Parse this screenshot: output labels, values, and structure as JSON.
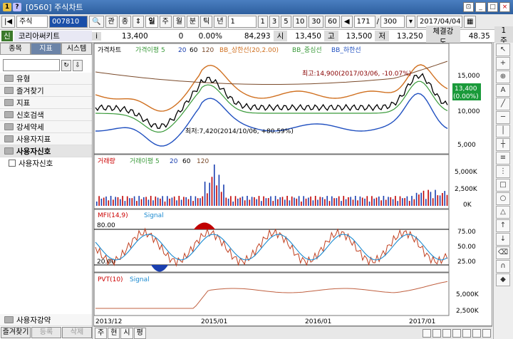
{
  "window": {
    "title": "[0560] 주식차트"
  },
  "toolbar": {
    "market": "주식",
    "code": "007810",
    "periods": [
      "일",
      "주",
      "월",
      "분",
      "틱",
      "년"
    ],
    "minutes": [
      "1",
      "3",
      "5",
      "10",
      "30",
      "60"
    ],
    "count": "171",
    "count_total": "300",
    "date": "2017/04/04",
    "check_labels": [
      "관",
      "종"
    ]
  },
  "quote": {
    "badge": "신",
    "name": "코리아써키트",
    "price": "13,400",
    "change": "0",
    "rate": "0.00%",
    "volume": "84,293",
    "open_label": "시",
    "open": "13,450",
    "high_label": "고",
    "high": "13,500",
    "low_label": "저",
    "low": "13,250",
    "strength_label": "체결강도",
    "strength": "48.35",
    "unit": "1주"
  },
  "sidebar": {
    "tabs": [
      "종목",
      "지표",
      "시스템"
    ],
    "folders": [
      "유형",
      "즐겨찾기",
      "지표",
      "신호검색",
      "강세약세",
      "사용자지표",
      "사용자신호"
    ],
    "sub_item": "사용자신호",
    "bottom_folder": "사용자강약",
    "foot": [
      "즐겨찾기",
      "등록",
      "삭제"
    ]
  },
  "price_panel": {
    "legend": [
      "가격차트",
      "가격이평 5",
      "20",
      "60",
      "120",
      "BB_상한선(20,2.00)",
      "BB_중심선",
      "BB_하한선"
    ],
    "max_note": "최고:14,900(2017/03/06, -10.07%)",
    "min_note": "최저:7,420(2014/10/06, +80.59%)",
    "ticks": [
      "15,000",
      "10,000",
      "5,000"
    ],
    "current": "13,400",
    "current_rate": "(0.00%)"
  },
  "volume_panel": {
    "legend": [
      "거래량",
      "거래이평 5",
      "20",
      "60",
      "120"
    ],
    "ticks": [
      "5,000K",
      "2,500K",
      "0K"
    ]
  },
  "mfi_panel": {
    "legend": [
      "MFI(14,9)",
      "Signal"
    ],
    "upper": "80.00",
    "lower": "20.00",
    "ticks": [
      "75.00",
      "50.00",
      "25.00"
    ]
  },
  "pvt_panel": {
    "legend": [
      "PVT(10)",
      "Signal"
    ],
    "ticks": [
      "5,000K",
      "2,500K"
    ]
  },
  "xaxis": [
    "2013/12",
    "2015/01",
    "2016/01",
    "2017/01"
  ],
  "bottombar": {
    "tabs": [
      "주",
      "현",
      "시",
      "평"
    ]
  },
  "colors": {
    "accent": "#1a4fa8",
    "price": "#000000",
    "ma5": "#3a9a3a",
    "bb_upper": "#d07020",
    "bb_lower": "#2050c0",
    "volume_up": "#c00000",
    "volume_down": "#1a3fb0"
  }
}
